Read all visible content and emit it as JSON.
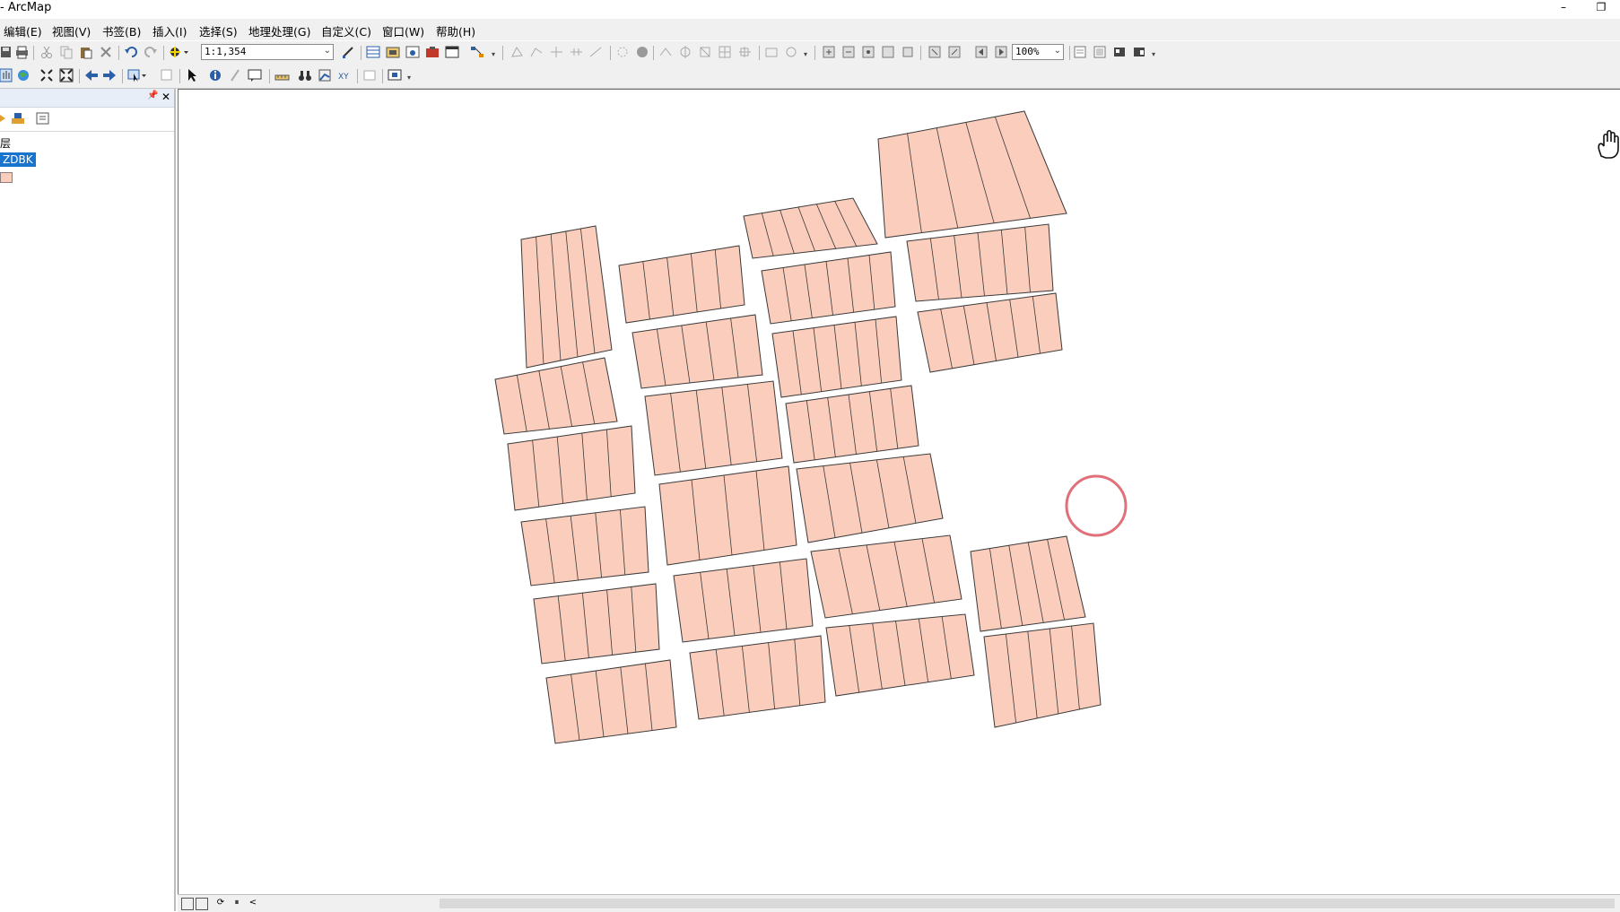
{
  "window": {
    "title": "- ArcMap",
    "minimize_glyph": "–",
    "restore_glyph": "❐"
  },
  "menus": [
    "编辑(E)",
    "视图(V)",
    "书签(B)",
    "插入(I)",
    "选择(S)",
    "地理处理(G)",
    "自定义(C)",
    "窗口(W)",
    "帮助(H)"
  ],
  "toolbar": {
    "scale": "1:1,354",
    "zoom": "100%"
  },
  "toc": {
    "pin_glyph": "📌",
    "close_glyph": "✕",
    "root_label": "层",
    "layer_name": "ZDBK",
    "symbol_color": "#fbcdbc"
  },
  "map": {
    "fill_color": "#fbcdbc",
    "stroke_color": "#3a3a3a",
    "cursor": "pan-hand-icon",
    "click_ring_color": "#e0707a"
  },
  "statusbar": {
    "scroll_left_glyph": "<"
  }
}
